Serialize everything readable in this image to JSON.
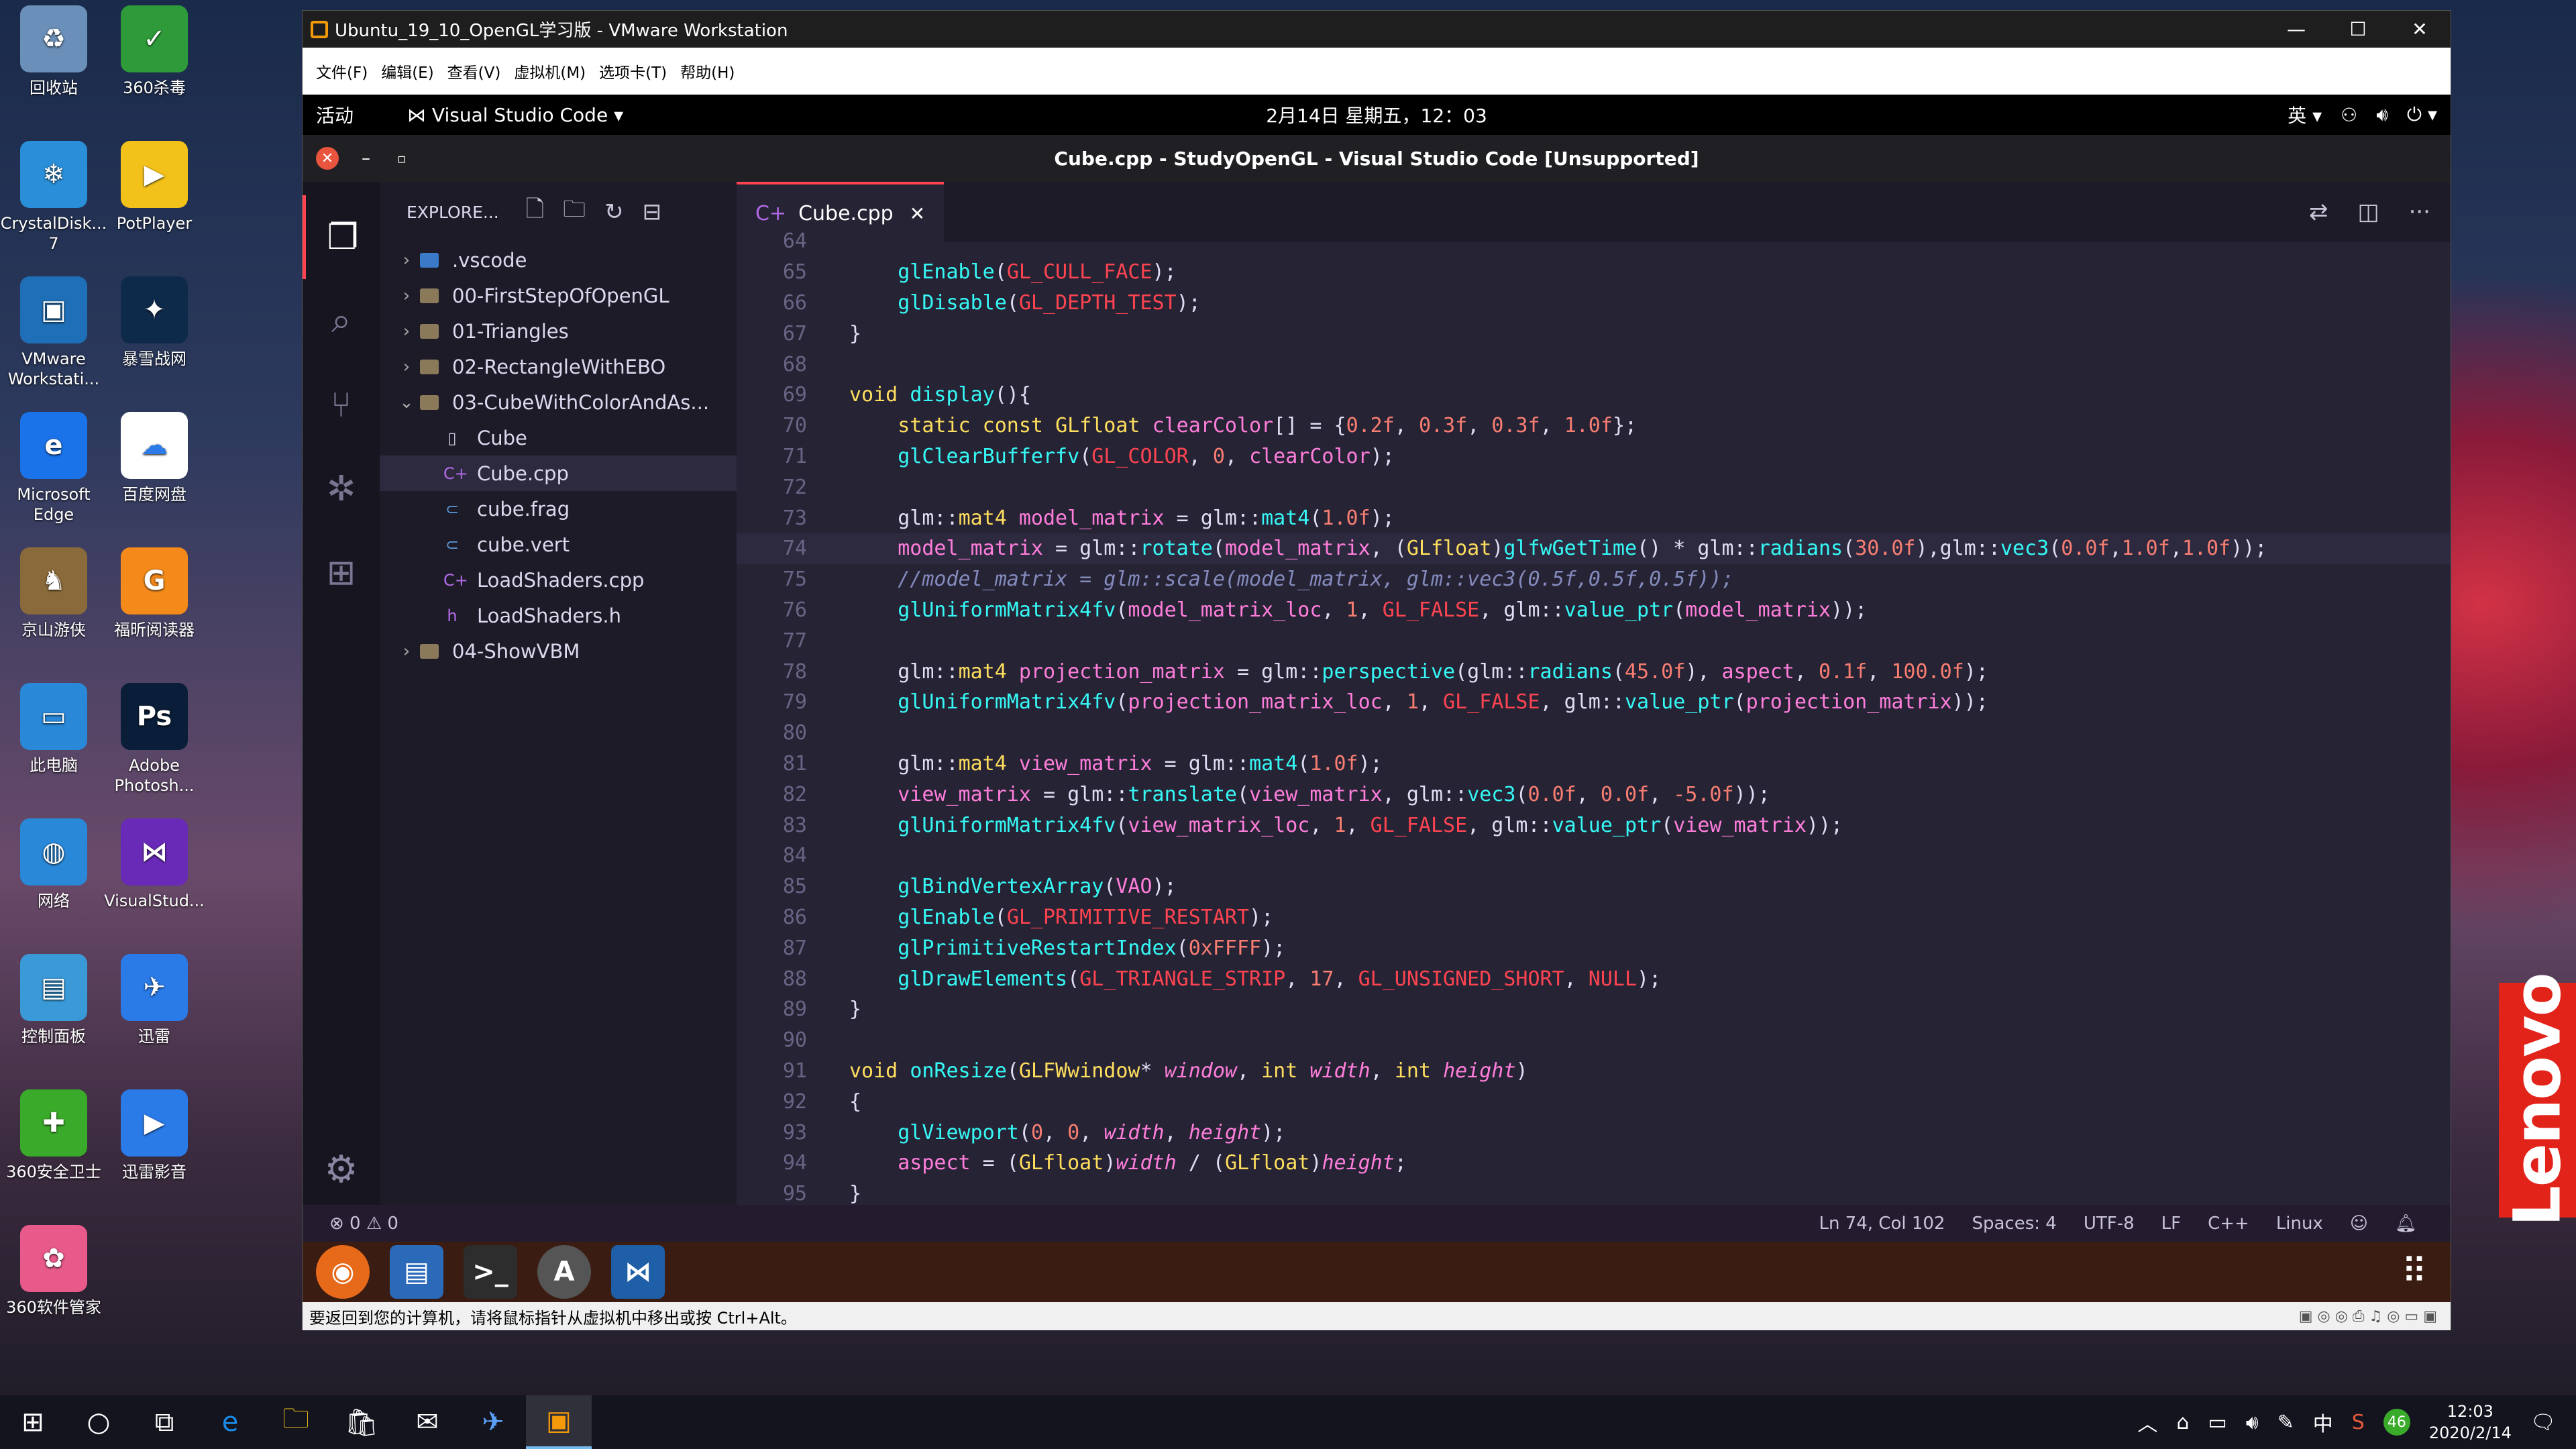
{
  "desktop": {
    "icons": [
      {
        "label": "回收站",
        "icon": "recycle-bin-icon",
        "color": "#6a8fb8",
        "glyph": "♻"
      },
      {
        "label": "360杀毒",
        "icon": "shield-icon",
        "color": "#2e9a3a",
        "glyph": "✓"
      },
      {
        "label": "CrystalDisk... 7",
        "icon": "crystal-disk-icon",
        "color": "#2a8fd8",
        "glyph": "❄"
      },
      {
        "label": "PotPlayer",
        "icon": "potplayer-icon",
        "color": "#f2c21a",
        "glyph": "▶"
      },
      {
        "label": "VMware Workstati...",
        "icon": "vmware-icon",
        "color": "#1f6fb8",
        "glyph": "▣"
      },
      {
        "label": "暴雪战网",
        "icon": "battlenet-icon",
        "color": "#0e2a4a",
        "glyph": "✦"
      },
      {
        "label": "Microsoft Edge",
        "icon": "edge-icon",
        "color": "#1a73e8",
        "glyph": "e"
      },
      {
        "label": "百度网盘",
        "icon": "baidu-netdisk-icon",
        "color": "#ffffff",
        "glyph": "☁"
      },
      {
        "label": "京山游侠",
        "icon": "game-icon",
        "color": "#8a6a3a",
        "glyph": "♞"
      },
      {
        "label": "福昕阅读器",
        "icon": "foxit-pdf-icon",
        "color": "#f48a1a",
        "glyph": "G"
      },
      {
        "label": "此电脑",
        "icon": "computer-icon",
        "color": "#2a88d8",
        "glyph": "▭"
      },
      {
        "label": "Adobe Photosh...",
        "icon": "photoshop-icon",
        "color": "#0a1e3a",
        "glyph": "Ps"
      },
      {
        "label": "网络",
        "icon": "network-icon",
        "color": "#2a88d8",
        "glyph": "◍"
      },
      {
        "label": "VisualStud...",
        "icon": "visual-studio-icon",
        "color": "#6a2ab8",
        "glyph": "⋈"
      },
      {
        "label": "控制面板",
        "icon": "control-panel-icon",
        "color": "#3a9ad8",
        "glyph": "▤"
      },
      {
        "label": "迅雷",
        "icon": "thunder-icon",
        "color": "#2a7ae8",
        "glyph": "✈"
      },
      {
        "label": "360安全卫士",
        "icon": "360-safe-icon",
        "color": "#3aaa2a",
        "glyph": "✚"
      },
      {
        "label": "迅雷影音",
        "icon": "thunder-player-icon",
        "color": "#2a7ae8",
        "glyph": "▶"
      },
      {
        "label": "360软件管家",
        "icon": "360-software-icon",
        "color": "#e85a8a",
        "glyph": "✿"
      }
    ],
    "lenovo_text": "Lenovo"
  },
  "vmware": {
    "title": "Ubuntu_19_10_OpenGL学习版 - VMware Workstation",
    "menu": [
      "文件(F)",
      "编辑(E)",
      "查看(V)",
      "虚拟机(M)",
      "选项卡(T)",
      "帮助(H)"
    ],
    "status_text": "要返回到您的计算机，请将鼠标指针从虚拟机中移出或按 Ctrl+Alt。"
  },
  "gnome": {
    "activities": "活动",
    "app_name": "Visual Studio Code",
    "clock": "2月14日 星期五，12：03",
    "lang": "英"
  },
  "vscode": {
    "window_title": "Cube.cpp - StudyOpenGL - Visual Studio Code [Unsupported]",
    "explorer_title": "EXPLORE...",
    "tree": [
      {
        "label": ".vscode",
        "kind": "folder",
        "depth": 0,
        "chev": "›"
      },
      {
        "label": "00-FirstStepOfOpenGL",
        "kind": "folder",
        "depth": 0,
        "chev": "›"
      },
      {
        "label": "01-Triangles",
        "kind": "folder",
        "depth": 0,
        "chev": "›"
      },
      {
        "label": "02-RectangleWithEBO",
        "kind": "folder",
        "depth": 0,
        "chev": "›"
      },
      {
        "label": "03-CubeWithColorAndAs...",
        "kind": "folder",
        "depth": 0,
        "chev": "⌄"
      },
      {
        "label": "Cube",
        "kind": "file",
        "depth": 1,
        "glyph": "▯",
        "color": "#c8c4d8"
      },
      {
        "label": "Cube.cpp",
        "kind": "file",
        "depth": 1,
        "glyph": "C+",
        "color": "#b26ae8",
        "selected": true
      },
      {
        "label": "cube.frag",
        "kind": "file",
        "depth": 1,
        "glyph": "⊂",
        "color": "#5a9ad8"
      },
      {
        "label": "cube.vert",
        "kind": "file",
        "depth": 1,
        "glyph": "⊂",
        "color": "#5a9ad8"
      },
      {
        "label": "LoadShaders.cpp",
        "kind": "file",
        "depth": 1,
        "glyph": "C+",
        "color": "#b26ae8"
      },
      {
        "label": "LoadShaders.h",
        "kind": "file",
        "depth": 1,
        "glyph": "h",
        "color": "#b26ae8"
      },
      {
        "label": "04-ShowVBM",
        "kind": "folder",
        "depth": 0,
        "chev": "›"
      }
    ],
    "tab_label": "Cube.cpp",
    "code_lines": [
      {
        "n": "64",
        "html": ""
      },
      {
        "n": "65",
        "html": "    <span class='fn'>glEnable</span>(<span class='ty'>GL_CULL_FACE</span>);"
      },
      {
        "n": "66",
        "html": "    <span class='fn'>glDisable</span>(<span class='ty'>GL_DEPTH_TEST</span>);"
      },
      {
        "n": "67",
        "html": "}"
      },
      {
        "n": "68",
        "html": ""
      },
      {
        "n": "69",
        "html": "<span class='kw'>void</span> <span class='fn'>display</span>(){"
      },
      {
        "n": "70",
        "html": "    <span class='kw'>static const</span> <span class='kw'>GLfloat</span> <span class='va'>clearColor</span>[] = {<span class='num'>0.2f</span>, <span class='num'>0.3f</span>, <span class='num'>0.3f</span>, <span class='num'>1.0f</span>};"
      },
      {
        "n": "71",
        "html": "    <span class='fn'>glClearBufferfv</span>(<span class='ty'>GL_COLOR</span>, <span class='num'>0</span>, <span class='va'>clearColor</span>);"
      },
      {
        "n": "72",
        "html": ""
      },
      {
        "n": "73",
        "html": "    glm::<span class='kw'>mat4</span> <span class='va'>model_matrix</span> = glm::<span class='fn'>mat4</span>(<span class='num'>1.0f</span>);"
      },
      {
        "n": "74",
        "html": "    <span class='va'>model_matrix</span> = glm::<span class='fn'>rotate</span>(<span class='va'>model_matrix</span>, (<span class='kw'>GLfloat</span>)<span class='fn'>glfwGetTime</span>() * glm::<span class='fn'>radians</span>(<span class='num'>30.0f</span>),glm::<span class='fn'>vec3</span>(<span class='num'>0.0f</span>,<span class='num'>1.0f</span>,<span class='num'>1.0f</span>));",
        "cur": true
      },
      {
        "n": "75",
        "html": "    <span class='cm'>//model_matrix = glm::scale(model_matrix, glm::vec3(0.5f,0.5f,0.5f));</span>"
      },
      {
        "n": "76",
        "html": "    <span class='fn'>glUniformMatrix4fv</span>(<span class='va'>model_matrix_loc</span>, <span class='num'>1</span>, <span class='ty'>GL_FALSE</span>, glm::<span class='fn'>value_ptr</span>(<span class='va'>model_matrix</span>));"
      },
      {
        "n": "77",
        "html": ""
      },
      {
        "n": "78",
        "html": "    glm::<span class='kw'>mat4</span> <span class='va'>projection_matrix</span> = glm::<span class='fn'>perspective</span>(glm::<span class='fn'>radians</span>(<span class='num'>45.0f</span>), <span class='va'>aspect</span>, <span class='num'>0.1f</span>, <span class='num'>100.0f</span>);"
      },
      {
        "n": "79",
        "html": "    <span class='fn'>glUniformMatrix4fv</span>(<span class='va'>projection_matrix_loc</span>, <span class='num'>1</span>, <span class='ty'>GL_FALSE</span>, glm::<span class='fn'>value_ptr</span>(<span class='va'>projection_matrix</span>));"
      },
      {
        "n": "80",
        "html": ""
      },
      {
        "n": "81",
        "html": "    glm::<span class='kw'>mat4</span> <span class='va'>view_matrix</span> = glm::<span class='fn'>mat4</span>(<span class='num'>1.0f</span>);"
      },
      {
        "n": "82",
        "html": "    <span class='va'>view_matrix</span> = glm::<span class='fn'>translate</span>(<span class='va'>view_matrix</span>, glm::<span class='fn'>vec3</span>(<span class='num'>0.0f</span>, <span class='num'>0.0f</span>, <span class='num'>-5.0f</span>));"
      },
      {
        "n": "83",
        "html": "    <span class='fn'>glUniformMatrix4fv</span>(<span class='va'>view_matrix_loc</span>, <span class='num'>1</span>, <span class='ty'>GL_FALSE</span>, glm::<span class='fn'>value_ptr</span>(<span class='va'>view_matrix</span>));"
      },
      {
        "n": "84",
        "html": ""
      },
      {
        "n": "85",
        "html": "    <span class='fn'>glBindVertexArray</span>(<span class='va'>VAO</span>);"
      },
      {
        "n": "86",
        "html": "    <span class='fn'>glEnable</span>(<span class='ty'>GL_PRIMITIVE_RESTART</span>);"
      },
      {
        "n": "87",
        "html": "    <span class='fn'>glPrimitiveRestartIndex</span>(<span class='num'>0xFFFF</span>);"
      },
      {
        "n": "88",
        "html": "    <span class='fn'>glDrawElements</span>(<span class='ty'>GL_TRIANGLE_STRIP</span>, <span class='num'>17</span>, <span class='ty'>GL_UNSIGNED_SHORT</span>, <span class='ty'>NULL</span>);"
      },
      {
        "n": "89",
        "html": "}"
      },
      {
        "n": "90",
        "html": ""
      },
      {
        "n": "91",
        "html": "<span class='kw'>void</span> <span class='fn'>onResize</span>(<span class='kw'>GLFWwindow</span>* <span class='pa'>window</span>, <span class='kw'>int</span> <span class='pa'>width</span>, <span class='kw'>int</span> <span class='pa'>height</span>)"
      },
      {
        "n": "92",
        "html": "{"
      },
      {
        "n": "93",
        "html": "    <span class='fn'>glViewport</span>(<span class='num'>0</span>, <span class='num'>0</span>, <span class='pa'>width</span>, <span class='pa'>height</span>);"
      },
      {
        "n": "94",
        "html": "    <span class='va'>aspect</span> = (<span class='kw'>GLfloat</span>)<span class='pa'>width</span> / (<span class='kw'>GLfloat</span>)<span class='pa'>height</span>;"
      },
      {
        "n": "95",
        "html": "}"
      }
    ],
    "status": {
      "problems": "⊗ 0 ⚠ 0",
      "position": "Ln 74, Col 102",
      "spaces": "Spaces: 4",
      "encoding": "UTF-8",
      "eol": "LF",
      "language": "C++",
      "platform": "Linux"
    }
  },
  "taskbar": {
    "time": "12:03",
    "date": "2020/2/14",
    "ime": "中",
    "notif_count": "46"
  }
}
